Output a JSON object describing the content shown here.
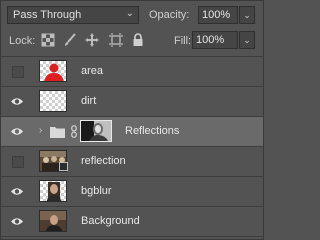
{
  "controls": {
    "blend_mode": "Pass Through",
    "opacity_label": "Opacity:",
    "opacity_value": "100%",
    "lock_label": "Lock:",
    "fill_label": "Fill:",
    "fill_value": "100%"
  },
  "layers": [
    {
      "name": "area",
      "visible": false,
      "thumb": "red-silhouette"
    },
    {
      "name": "dirt",
      "visible": true,
      "thumb": "transparent"
    },
    {
      "name": "Reflections",
      "visible": true,
      "thumb": "group-with-mask",
      "selected": true
    },
    {
      "name": "reflection",
      "visible": false,
      "thumb": "photo-smart-object"
    },
    {
      "name": "bgblur",
      "visible": true,
      "thumb": "photo"
    },
    {
      "name": "Background",
      "visible": true,
      "thumb": "photo-dark"
    }
  ],
  "colors": {
    "panel_bg": "#535353",
    "selected_row": "#6a6a6a",
    "silhouette_red": "#e02020"
  }
}
